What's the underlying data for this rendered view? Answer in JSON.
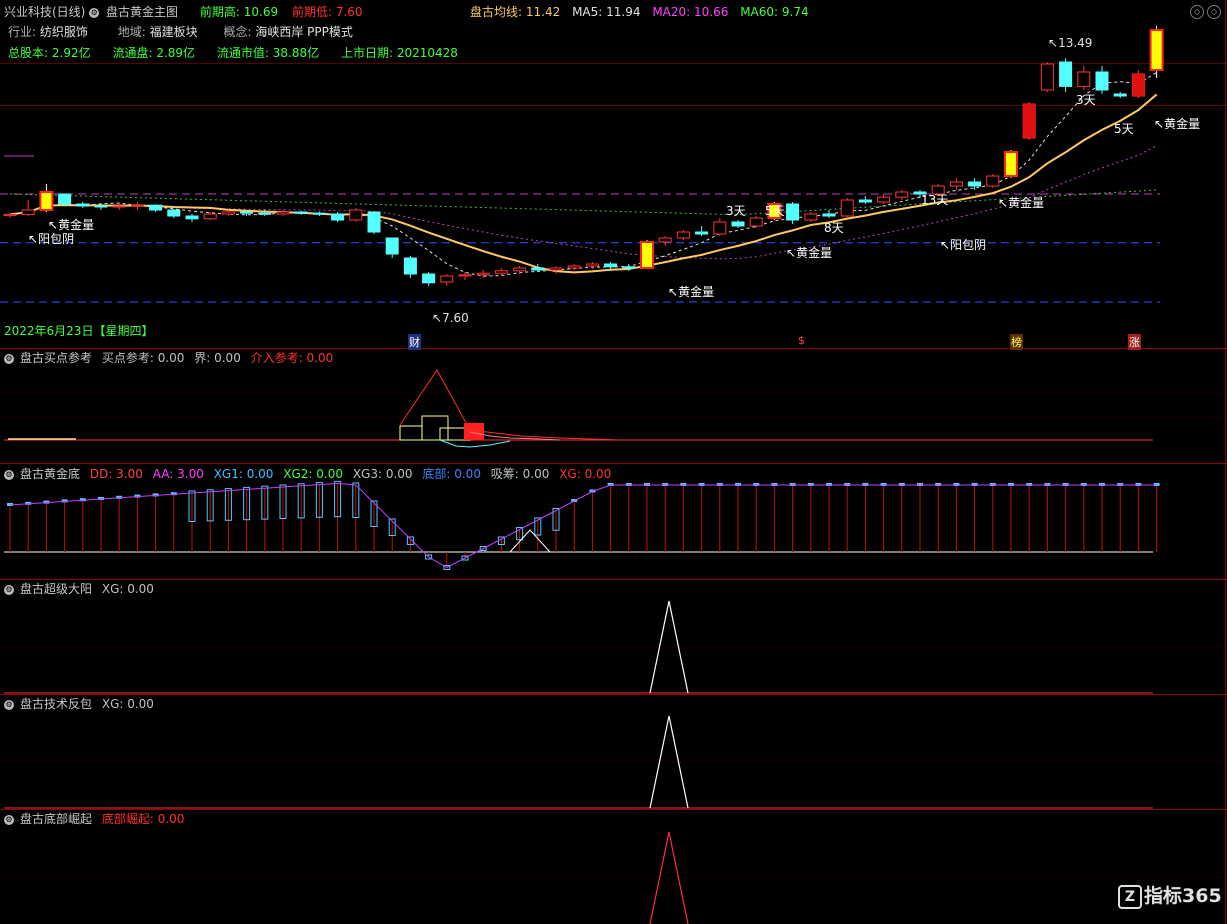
{
  "header": {
    "stock": "兴业科技(日线)",
    "indicator": "盘古黄金主图",
    "prev_high_label": "前期高:",
    "prev_high": "10.69",
    "prev_low_label": "前期低:",
    "prev_low": "7.60",
    "ma_label": "盘古均线:",
    "ma": "11.42",
    "ma5": "MA5: 11.94",
    "ma20": "MA20: 10.66",
    "ma60": "MA60: 9.74"
  },
  "info": {
    "industry_label": "行业:",
    "industry": "纺织服饰",
    "region_label": "地域:",
    "region": "福建板块",
    "concept_label": "概念:",
    "concept": "海峡西岸 PPP模式",
    "total_label": "总股本:",
    "total": "2.92亿",
    "float_label": "流通盘:",
    "float": "2.89亿",
    "mcap_label": "流通市值:",
    "mcap": "38.88亿",
    "ipo_label": "上市日期:",
    "ipo": "20210428"
  },
  "main_annotations": {
    "high_label": "13.49",
    "low_label": "7.60",
    "date_label": "2022年6月23日【星期四】",
    "golden": "黄金量",
    "yangbao": "阳包阴",
    "d3": "3天",
    "d5": "5天",
    "d8": "8天",
    "d13": "13天",
    "marker_cai": "财",
    "marker_s": "$",
    "marker_bang": "榜",
    "marker_zhang": "涨"
  },
  "panels": [
    {
      "name": "盘古买点参考",
      "fields": [
        {
          "t": "买点参考: 0.00",
          "c": "#c0c0c0"
        },
        {
          "t": "界: 0.00",
          "c": "#c0c0c0"
        },
        {
          "t": "介入参考: 0.00",
          "c": "#ff3030"
        }
      ]
    },
    {
      "name": "盘古黄金底",
      "fields": [
        {
          "t": "DD: 3.00",
          "c": "#ff4040"
        },
        {
          "t": "AA: 3.00",
          "c": "#ff40ff"
        },
        {
          "t": "XG1: 0.00",
          "c": "#40c0ff"
        },
        {
          "t": "XG2: 0.00",
          "c": "#40ff40"
        },
        {
          "t": "XG3: 0.00",
          "c": "#c0c0c0"
        },
        {
          "t": "底部: 0.00",
          "c": "#4080ff"
        },
        {
          "t": "吸筹: 0.00",
          "c": "#c0c0c0"
        },
        {
          "t": "XG: 0.00",
          "c": "#ff3030"
        }
      ]
    },
    {
      "name": "盘古超级大阳",
      "fields": [
        {
          "t": "XG: 0.00",
          "c": "#c0c0c0"
        }
      ]
    },
    {
      "name": "盘古技术反包",
      "fields": [
        {
          "t": "XG: 0.00",
          "c": "#c0c0c0"
        }
      ]
    },
    {
      "name": "盘古底部崛起",
      "fields": [
        {
          "t": "底部崛起: 0.00",
          "c": "#ff3030"
        }
      ]
    }
  ],
  "brand": "指标365",
  "colors": {
    "up": "#ff3232",
    "down": "#54ffff",
    "ma": "#ffc864",
    "golden": "#ffff00"
  },
  "candles": [
    [
      7.46,
      7.52,
      7.4,
      7.49
    ],
    [
      7.49,
      7.85,
      7.45,
      7.6
    ],
    [
      7.6,
      8.25,
      7.55,
      8.05
    ],
    [
      8.0,
      7.95,
      7.7,
      7.75
    ],
    [
      7.75,
      7.8,
      7.65,
      7.7
    ],
    [
      7.7,
      7.75,
      7.6,
      7.68
    ],
    [
      7.68,
      7.76,
      7.6,
      7.7
    ],
    [
      7.7,
      7.8,
      7.6,
      7.72
    ],
    [
      7.72,
      7.74,
      7.55,
      7.6
    ],
    [
      7.6,
      7.62,
      7.4,
      7.45
    ],
    [
      7.45,
      7.5,
      7.3,
      7.38
    ],
    [
      7.38,
      7.55,
      7.35,
      7.5
    ],
    [
      7.5,
      7.6,
      7.45,
      7.55
    ],
    [
      7.55,
      7.58,
      7.45,
      7.52
    ],
    [
      7.52,
      7.6,
      7.45,
      7.5
    ],
    [
      7.5,
      7.6,
      7.45,
      7.55
    ],
    [
      7.55,
      7.58,
      7.48,
      7.52
    ],
    [
      7.52,
      7.56,
      7.45,
      7.5
    ],
    [
      7.5,
      7.55,
      7.3,
      7.35
    ],
    [
      7.35,
      7.65,
      7.3,
      7.6
    ],
    [
      7.55,
      7.55,
      7.0,
      7.05
    ],
    [
      6.9,
      6.9,
      6.4,
      6.5
    ],
    [
      6.4,
      6.45,
      5.9,
      6.0
    ],
    [
      6.0,
      6.05,
      5.7,
      5.78
    ],
    [
      5.8,
      6.0,
      5.7,
      5.95
    ],
    [
      5.95,
      6.05,
      5.85,
      5.98
    ],
    [
      5.98,
      6.1,
      5.9,
      6.02
    ],
    [
      6.02,
      6.15,
      5.95,
      6.08
    ],
    [
      6.08,
      6.2,
      6.0,
      6.15
    ],
    [
      6.15,
      6.25,
      6.05,
      6.1
    ],
    [
      6.1,
      6.2,
      6.0,
      6.15
    ],
    [
      6.15,
      6.25,
      6.1,
      6.2
    ],
    [
      6.2,
      6.3,
      6.12,
      6.25
    ],
    [
      6.25,
      6.3,
      6.12,
      6.18
    ],
    [
      6.18,
      6.25,
      6.08,
      6.15
    ],
    [
      6.15,
      6.85,
      6.12,
      6.8
    ],
    [
      6.8,
      6.95,
      6.7,
      6.9
    ],
    [
      6.9,
      7.1,
      6.85,
      7.05
    ],
    [
      7.05,
      7.2,
      6.95,
      7.0
    ],
    [
      7.0,
      7.4,
      6.95,
      7.3
    ],
    [
      7.3,
      7.35,
      7.15,
      7.2
    ],
    [
      7.2,
      7.45,
      7.15,
      7.4
    ],
    [
      7.4,
      7.8,
      7.35,
      7.75
    ],
    [
      7.75,
      7.8,
      7.25,
      7.35
    ],
    [
      7.35,
      7.55,
      7.3,
      7.5
    ],
    [
      7.5,
      7.6,
      7.4,
      7.45
    ],
    [
      7.45,
      7.9,
      7.4,
      7.85
    ],
    [
      7.85,
      7.95,
      7.75,
      7.8
    ],
    [
      7.8,
      8.0,
      7.75,
      7.92
    ],
    [
      7.92,
      8.1,
      7.85,
      8.05
    ],
    [
      8.05,
      8.1,
      7.9,
      8.0
    ],
    [
      8.0,
      8.25,
      7.95,
      8.2
    ],
    [
      8.2,
      8.4,
      8.1,
      8.3
    ],
    [
      8.3,
      8.4,
      8.1,
      8.2
    ],
    [
      8.2,
      8.5,
      8.15,
      8.45
    ],
    [
      8.45,
      9.1,
      8.4,
      9.05
    ],
    [
      9.4,
      10.3,
      9.35,
      10.25
    ],
    [
      10.6,
      11.3,
      10.55,
      11.25
    ],
    [
      11.3,
      11.4,
      10.55,
      10.69
    ],
    [
      10.69,
      11.2,
      10.6,
      11.05
    ],
    [
      11.05,
      11.2,
      10.5,
      10.6
    ],
    [
      10.5,
      10.55,
      10.4,
      10.45
    ],
    [
      10.45,
      11.1,
      10.4,
      11.0
    ],
    [
      11.1,
      12.2,
      10.9,
      12.1
    ]
  ]
}
